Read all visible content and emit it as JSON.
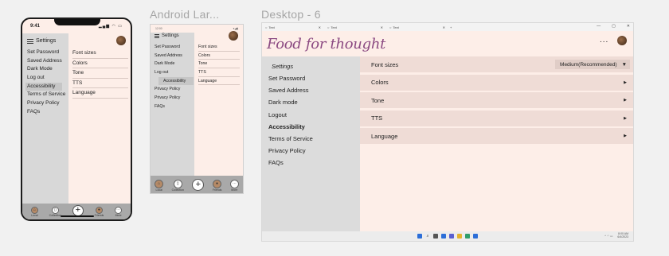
{
  "frames": {
    "android_title": "Android Lar...",
    "desktop_title": "Desktop - 6"
  },
  "iphone": {
    "time": "9:41",
    "header": "Settings",
    "nav": [
      "Set Password",
      "Saved Address",
      "Dark Mode",
      "Log out",
      "Accessibility",
      "Terms of Service",
      "Privacy Policy",
      "FAQs"
    ],
    "active_nav": "Accessibility",
    "sub": [
      "Font sizes",
      "Colors",
      "Tone",
      "TTS",
      "Language"
    ],
    "tabbar": [
      "Local",
      "Collection",
      "",
      "Friends",
      "More"
    ]
  },
  "android": {
    "time": "12:00",
    "header": "Settings",
    "nav": [
      "Set Password",
      "Saved Address",
      "Dark Mode",
      "Log out",
      "Accessibility",
      "Privacy Policy",
      "Privacy Policy",
      "FAQs"
    ],
    "active_nav": "Accessibility",
    "sub": [
      "Font sizes",
      "Colors",
      "Tone",
      "TTS",
      "Language"
    ],
    "tabbar": [
      "Local",
      "Collection",
      "",
      "Friends",
      "More"
    ]
  },
  "desktop": {
    "browser_tabs": [
      "Text",
      "Text",
      "Text"
    ],
    "logo": "Food for thought",
    "more": "...",
    "settings_heading": "Settings",
    "nav": [
      "Set Password",
      "Saved Address",
      "Dark mode",
      "Logout",
      "Accessibility",
      "Terms of Service",
      "Privacy Policy",
      "FAQs"
    ],
    "active_nav": "Accessibility",
    "rows": [
      {
        "label": "Font sizes",
        "value": "Medium(Recommended)"
      },
      {
        "label": "Colors"
      },
      {
        "label": "Tone"
      },
      {
        "label": "TTS"
      },
      {
        "label": "Language"
      }
    ],
    "clock_time": "8:00 AM",
    "clock_date": "6/4/2023"
  },
  "colors": {
    "page_bg": "#fdeee8",
    "sidebar": "#d8d8d8",
    "row": "#efdcd6",
    "logo": "#8b4a82"
  }
}
